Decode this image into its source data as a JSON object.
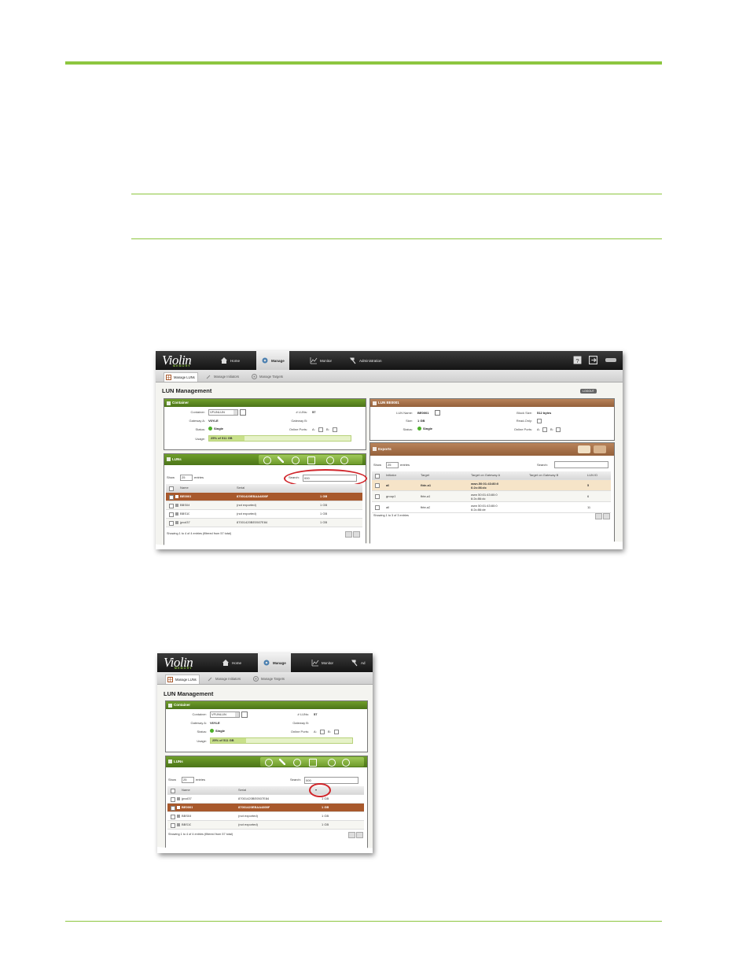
{
  "shot1": {
    "logo": "Violin",
    "logo_sub": "MEMORY",
    "nav": [
      "Home",
      "Manage",
      "Monitor",
      "Administration"
    ],
    "subtabs": [
      "Manage LUNs",
      "Manage Initiators",
      "Manage Targets"
    ],
    "page_title": "LUN Management",
    "page_btn": "LOGOUT",
    "container": {
      "title": "Container",
      "container_label": "Container:",
      "container_value": "VFUNLUN",
      "gateway_a_label": "Gateway A:",
      "gateway_a_value": "V6YLE",
      "status_label": "Status:",
      "status_value": "Single",
      "usage_label": "Usage:",
      "usage_value": "25% of 511 GB",
      "usage_fraction": 0.25,
      "luns_label": "# LUNs:",
      "luns_value": "57",
      "gateway_b_label": "Gateway B:",
      "online_ports_label": "Online Ports:",
      "port_a": "A:",
      "port_b": "B:"
    },
    "luns": {
      "title": "LUNs",
      "show": "Show",
      "entries_count": "25",
      "entries": "entries",
      "search_label": "Search:",
      "search_value": "000",
      "columns": [
        "Name",
        "Serial",
        ""
      ],
      "rows": [
        {
          "name": "BE0001",
          "serial": "87001420EBAA4800F",
          "size": "1 GB",
          "selected": true
        },
        {
          "name": "BBS04",
          "serial": "(not exported)",
          "size": "1 GB",
          "selected": false
        },
        {
          "name": "BBS10",
          "serial": "(not exported)",
          "size": "1 GB",
          "selected": false
        },
        {
          "name": "jpvol37",
          "serial": "87001420BE0507E84",
          "size": "1 GB",
          "selected": false
        }
      ],
      "footer": "Showing 1 to 4 of 4 entries (filtered from 57 total)"
    },
    "lun_detail": {
      "title": "LUN BE0001",
      "lun_name_label": "LUN Name:",
      "lun_name_value": "BE0001",
      "size_label": "Size:",
      "size_value": "1 GB",
      "status_label": "Status:",
      "status_value": "Single",
      "block_size_label": "Block Size:",
      "block_size_value": "512 bytes",
      "read_only_label": "Read-Only:",
      "online_ports_label": "Online Ports:",
      "port_a": "A:",
      "port_b": "B:"
    },
    "exports": {
      "title": "Exports",
      "show": "Show",
      "entries_count": "25",
      "entries": "entries",
      "search_label": "Search:",
      "columns": [
        "Initiator",
        "Target",
        "Target on Gateway A",
        "Target on Gateway B",
        "LUN ID"
      ],
      "rows": [
        {
          "initiator": "all",
          "target": "fbte-a1",
          "gw_a": "wwn.50:01:43:80:0\n6:2c:86:dc",
          "gw_b": "",
          "lun_id": "5",
          "selected": true
        },
        {
          "initiator": "group1",
          "target": "fbte-a1",
          "gw_a": "wwn 50:01:43:80:0\n6:2c:86:dc",
          "gw_b": "",
          "lun_id": "6",
          "selected": false
        },
        {
          "initiator": "all",
          "target": "fbte-a2",
          "gw_a": "wwn 50:01:43:80:0\n6:2c:86:de",
          "gw_b": "",
          "lun_id": "11",
          "selected": false
        }
      ],
      "footer": "Showing 1 to 3 of 3 entries"
    }
  },
  "shot2": {
    "logo": "Violin",
    "logo_sub": "MEMORY",
    "nav": [
      "Home",
      "Manage",
      "Monitor",
      "Ad"
    ],
    "subtabs": [
      "Manage LUNs",
      "Manage Initiators",
      "Manage Targets"
    ],
    "page_title": "LUN Management",
    "container": {
      "title": "Container",
      "container_label": "Container:",
      "container_value": "VFUNLUN",
      "gateway_a_label": "Gateway A:",
      "gateway_a_value": "V6YLE",
      "status_label": "Status:",
      "status_value": "Single",
      "usage_label": "Usage:",
      "usage_value": "25% of 511 GB",
      "usage_fraction": 0.25,
      "luns_label": "# LUNs:",
      "luns_value": "57",
      "gateway_b_label": "Gateway B:",
      "online_ports_label": "Online Ports:",
      "port_a": "A:",
      "port_b": "B:"
    },
    "luns": {
      "title": "LUNs",
      "show": "Show",
      "entries_count": "25",
      "entries": "entries",
      "search_label": "Search:",
      "search_value": "000",
      "columns": [
        "Name",
        "Serial",
        ""
      ],
      "rows": [
        {
          "name": "jpvol37",
          "serial": "87001420BE0507E84",
          "size": "1 GB",
          "selected": false
        },
        {
          "name": "BE0001",
          "serial": "87001420EBAA4800F",
          "size": "1 GB",
          "selected": true
        },
        {
          "name": "BBS04",
          "serial": "(not exported)",
          "size": "1 GB",
          "selected": false
        },
        {
          "name": "BBS10",
          "serial": "(not exported)",
          "size": "1 GB",
          "selected": false
        }
      ],
      "footer": "Showing 1 to 4 of 4 entries (filtered from 57 total)"
    }
  },
  "colors": {
    "rule": "#8dc63f",
    "green_header": "#5a8a20",
    "brown_header": "#a8592c",
    "highlight": "#d0262b"
  }
}
